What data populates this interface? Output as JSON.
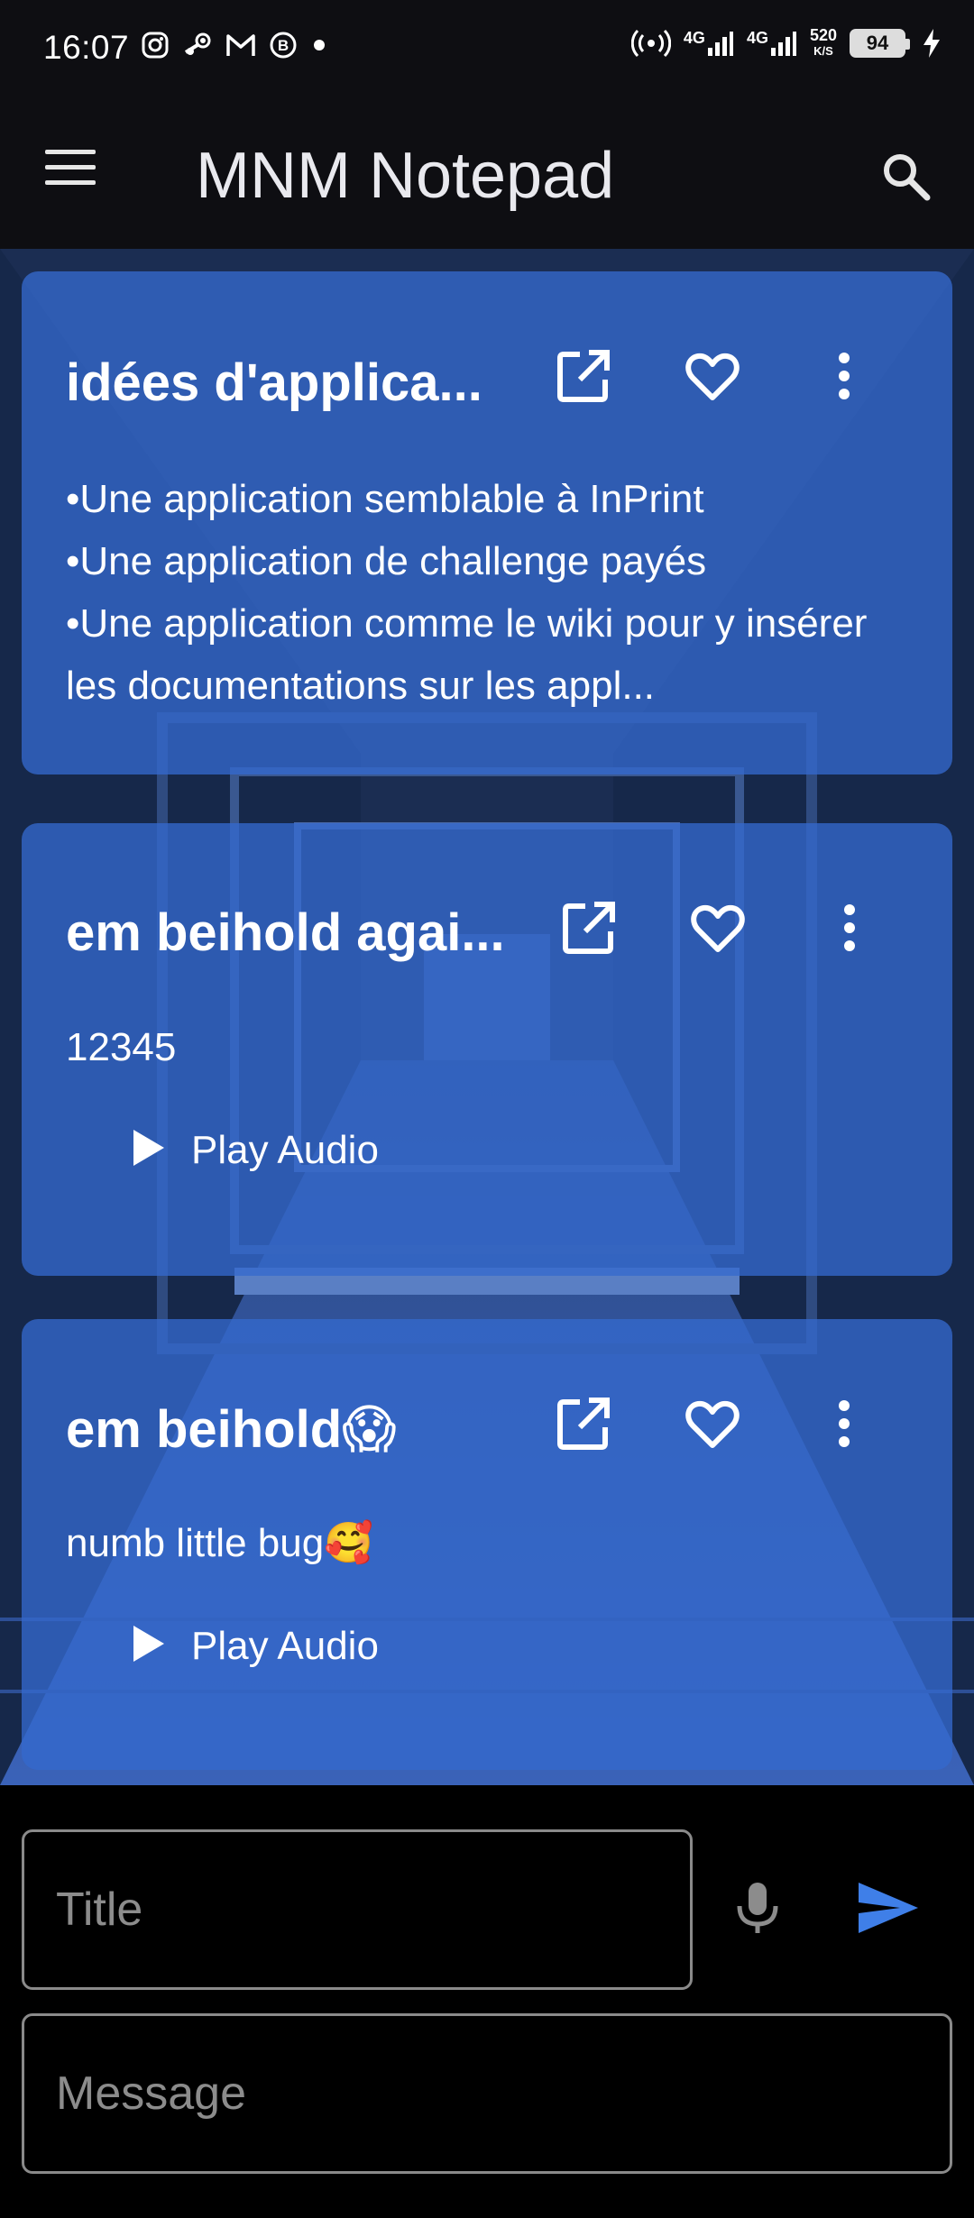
{
  "status_bar": {
    "time": "16:07",
    "left_icons": [
      "instagram-icon",
      "steam-icon",
      "gmail-icon",
      "b-badge-icon",
      "dot-icon"
    ],
    "net_1": "4G",
    "net_2": "4G",
    "speed_value": "520",
    "speed_unit": "K/S",
    "battery": "94"
  },
  "app_bar": {
    "title": "MNM Notepad"
  },
  "notes": [
    {
      "title": "idées d'applica...",
      "lines": [
        "•Une application semblable à InPrint",
        "•Une application de challenge payés",
        "•Une application comme le wiki pour y insérer les documentations sur les appl..."
      ]
    },
    {
      "title": "em beihold agai...",
      "body": "12345",
      "audio_label": "Play Audio"
    },
    {
      "title": "em beihold😱",
      "body": "numb little bug🥰",
      "audio_label": "Play Audio"
    }
  ],
  "composer": {
    "title_placeholder": "Title",
    "message_placeholder": "Message"
  },
  "colors": {
    "card": "#3469cd",
    "accent_send": "#3f7fe8",
    "appbar": "#0e0e12"
  }
}
